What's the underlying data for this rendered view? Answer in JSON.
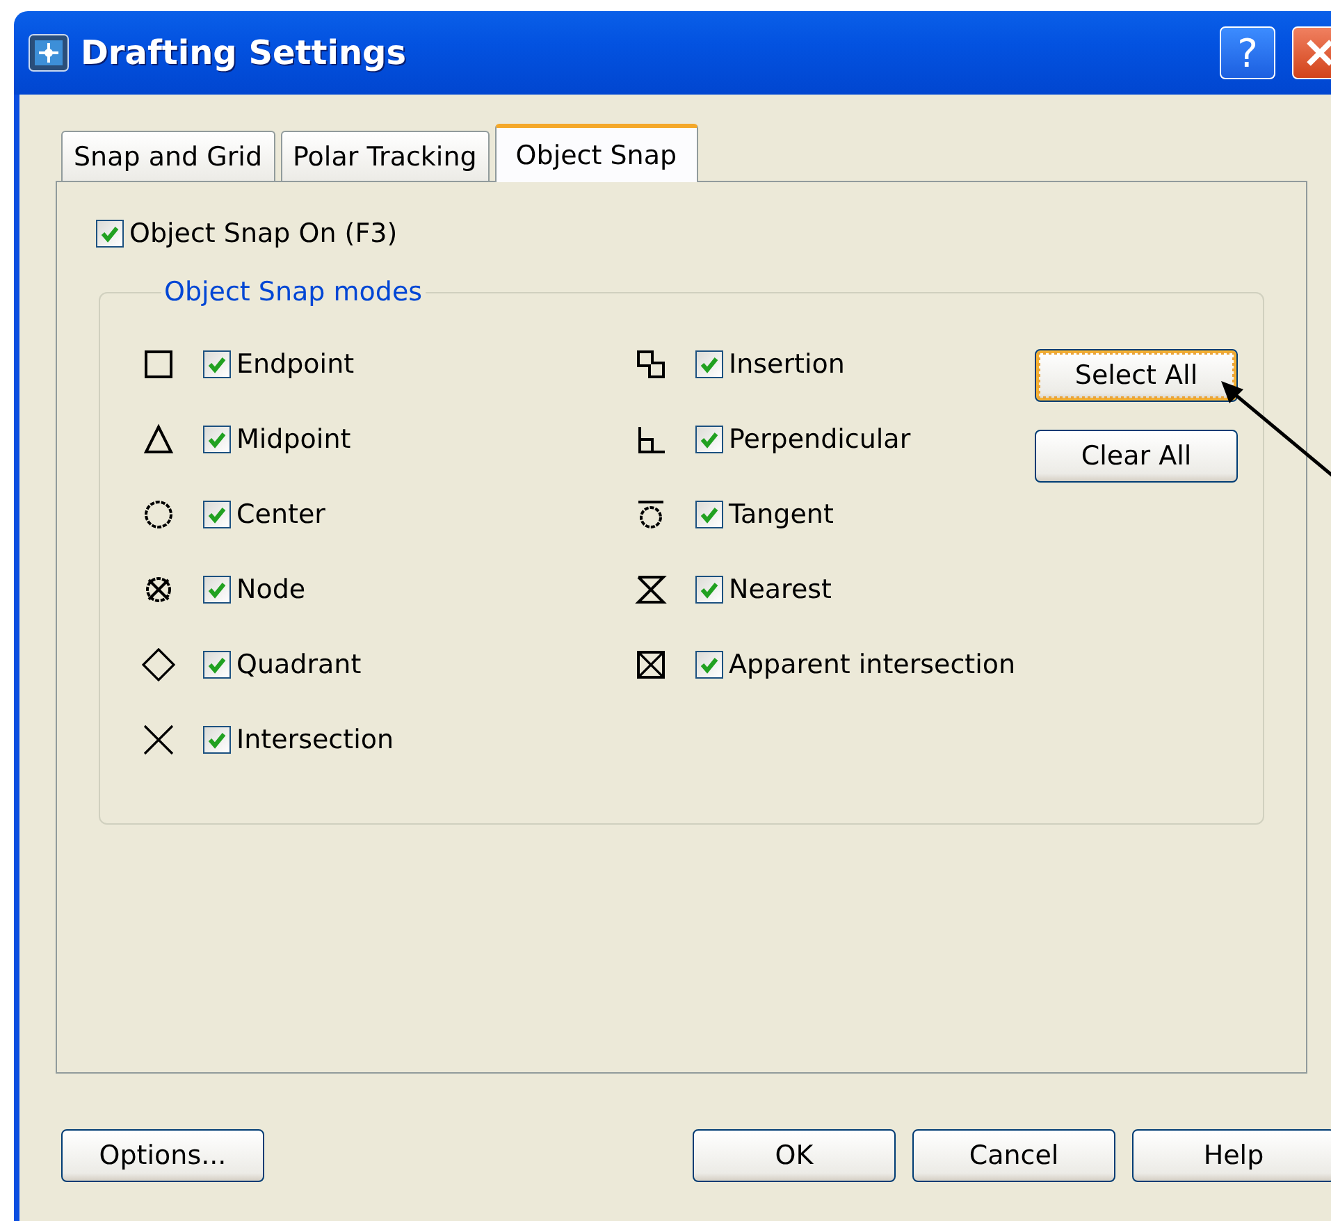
{
  "window": {
    "title": "Drafting Settings",
    "help_button": "?"
  },
  "tabs": [
    {
      "label": "Snap and Grid",
      "selected": false
    },
    {
      "label": "Polar Tracking",
      "selected": false
    },
    {
      "label": "Object Snap",
      "selected": true
    }
  ],
  "object_snap_on": {
    "label": "Object Snap On (F3)",
    "checked": true
  },
  "modes_group": {
    "title": "Object Snap modes",
    "left_column": [
      {
        "kind": "square",
        "label": "Endpoint",
        "checked": true
      },
      {
        "kind": "triangle",
        "label": "Midpoint",
        "checked": true
      },
      {
        "kind": "circle",
        "label": "Center",
        "checked": true
      },
      {
        "kind": "node",
        "label": "Node",
        "checked": true
      },
      {
        "kind": "diamond",
        "label": "Quadrant",
        "checked": true
      },
      {
        "kind": "cross",
        "label": "Intersection",
        "checked": true
      }
    ],
    "right_column": [
      {
        "kind": "insertion",
        "label": "Insertion",
        "checked": true
      },
      {
        "kind": "perpendicular",
        "label": "Perpendicular",
        "checked": true
      },
      {
        "kind": "tangent",
        "label": "Tangent",
        "checked": true
      },
      {
        "kind": "nearest",
        "label": "Nearest",
        "checked": true
      },
      {
        "kind": "apparent",
        "label": "Apparent intersection",
        "checked": true
      }
    ],
    "buttons": [
      {
        "label": "Select All",
        "focused": true
      },
      {
        "label": "Clear All",
        "focused": false
      }
    ]
  },
  "footer_buttons": {
    "left": [
      "Options..."
    ],
    "right": [
      "OK",
      "Cancel",
      "Help"
    ]
  }
}
